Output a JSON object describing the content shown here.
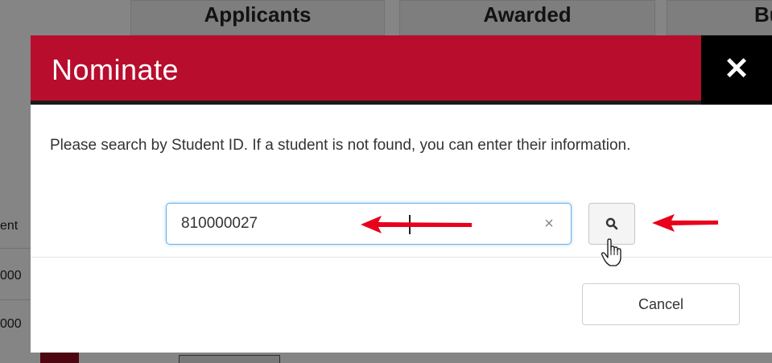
{
  "background": {
    "tabs": [
      "Applicants",
      "Awarded",
      "Bu"
    ],
    "left_fragments": [
      "ent",
      "000",
      "000"
    ]
  },
  "modal": {
    "title": "Nominate",
    "close_glyph": "✕",
    "instructions": "Please search by Student ID. If a student is not found, you can enter their information.",
    "search": {
      "value": "810000027",
      "clear_glyph": "×",
      "button_icon": "search-icon"
    },
    "footer": {
      "cancel_label": "Cancel"
    }
  },
  "colors": {
    "header_red": "#b80d2d",
    "annotation_arrow": "#e8001c",
    "focus_blue": "#66afe9"
  }
}
